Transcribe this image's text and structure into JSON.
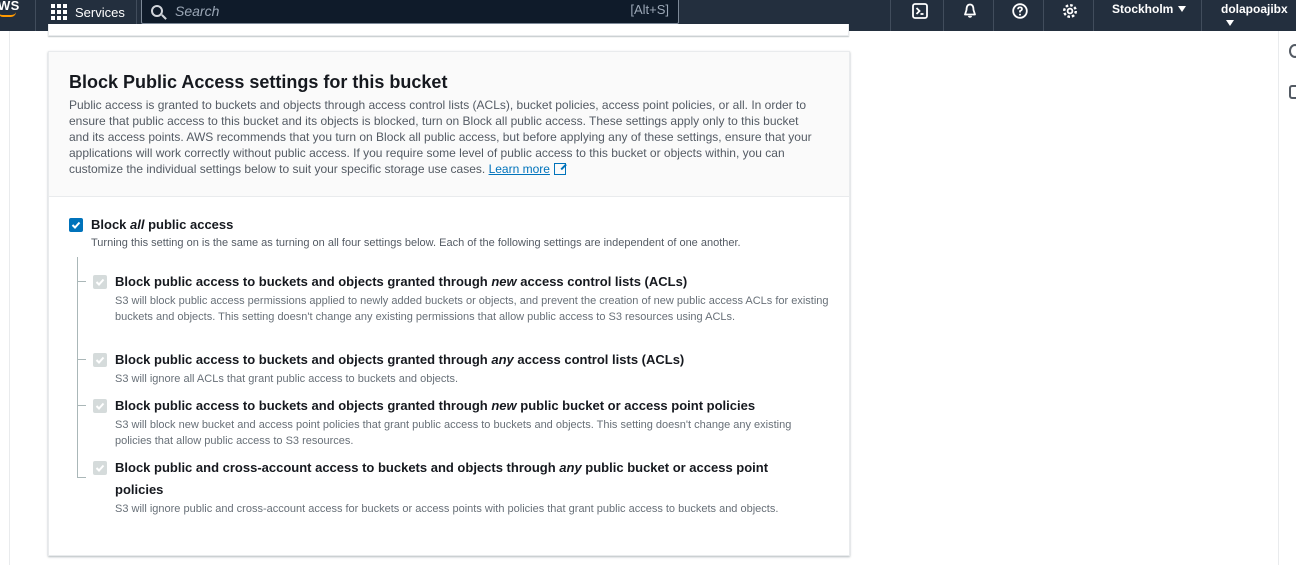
{
  "nav": {
    "logo": "WS",
    "services_label": "Services",
    "search_placeholder": "Search",
    "search_shortcut": "[Alt+S]",
    "region": "Stockholm",
    "user": "dolapoajibx"
  },
  "panel": {
    "title": "Block Public Access settings for this bucket",
    "description": "Public access is granted to buckets and objects through access control lists (ACLs), bucket policies, access point policies, or all. In order to ensure that public access to this bucket and its objects is blocked, turn on Block all public access. These settings apply only to this bucket and its access points. AWS recommends that you turn on Block all public access, but before applying any of these settings, ensure that your applications will work correctly without public access. If you require some level of public access to this bucket or objects within, you can customize the individual settings below to suit your specific storage use cases.",
    "learn_more": "Learn more"
  },
  "block_all": {
    "title_pre": "Block ",
    "title_em": "all",
    "title_post": " public access",
    "description": "Turning this setting on is the same as turning on all four settings below. Each of the following settings are independent of one another.",
    "checked": true
  },
  "options": [
    {
      "title_pre": "Block public access to buckets and objects granted through ",
      "title_em": "new",
      "title_post": " access control lists (ACLs)",
      "description": "S3 will block public access permissions applied to newly added buckets or objects, and prevent the creation of new public access ACLs for existing buckets and objects. This setting doesn't change any existing permissions that allow public access to S3 resources using ACLs.",
      "checked": true
    },
    {
      "title_pre": "Block public access to buckets and objects granted through ",
      "title_em": "any",
      "title_post": " access control lists (ACLs)",
      "description": "S3 will ignore all ACLs that grant public access to buckets and objects.",
      "checked": true
    },
    {
      "title_pre": "Block public access to buckets and objects granted through ",
      "title_em": "new",
      "title_post": " public bucket or access point policies",
      "description": "S3 will block new bucket and access point policies that grant public access to buckets and objects. This setting doesn't change any existing policies that allow public access to S3 resources.",
      "checked": true
    },
    {
      "title_pre": "Block public and cross-account access to buckets and objects through ",
      "title_em": "any",
      "title_post": " public bucket or access point policies",
      "description": "S3 will ignore public and cross-account access for buckets or access points with policies that grant public access to buckets and objects.",
      "checked": true
    }
  ]
}
